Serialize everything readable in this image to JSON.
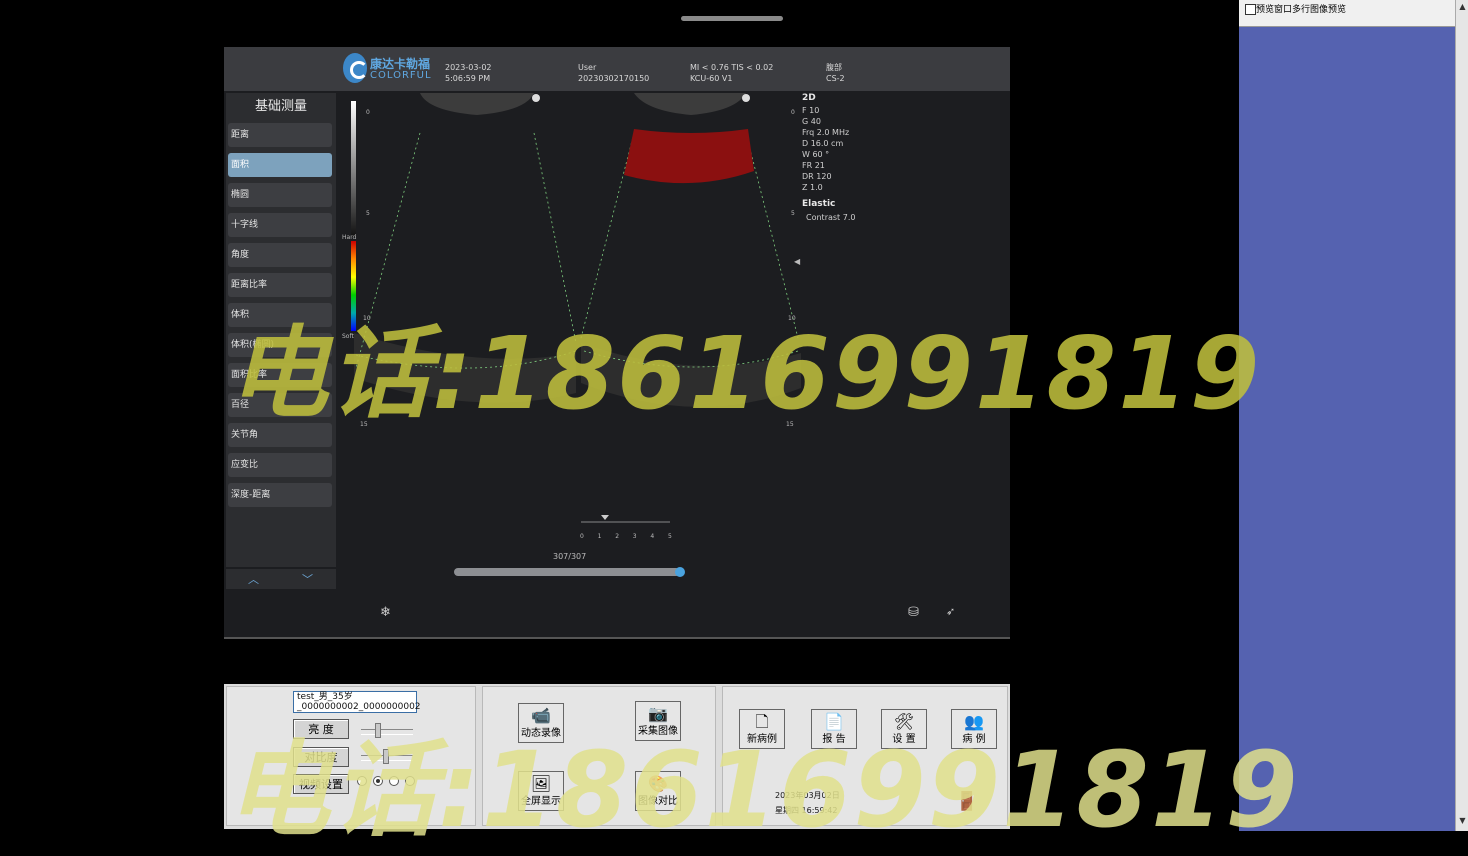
{
  "header": {
    "brand_cn": "康达卡勒福",
    "brand_en": "COLORFUL",
    "date": "2023-03-02",
    "time": "5:06:59 PM",
    "user": "User",
    "exam_id": "20230302170150",
    "mi_tis": "MI < 0.76  TIS < 0.02",
    "probe": "KCU-60 V1",
    "region": "腹部",
    "preset": "CS-2"
  },
  "menu": {
    "title": "基础测量",
    "items": [
      {
        "label": "距离",
        "selected": false
      },
      {
        "label": "面积",
        "selected": true
      },
      {
        "label": "椭圆",
        "selected": false
      },
      {
        "label": "十字线",
        "selected": false
      },
      {
        "label": "角度",
        "selected": false
      },
      {
        "label": "距离比率",
        "selected": false
      },
      {
        "label": "体积",
        "selected": false
      },
      {
        "label": "体积(椭圆)",
        "selected": false
      },
      {
        "label": "面积比率",
        "selected": false
      },
      {
        "label": "百径",
        "selected": false
      },
      {
        "label": "关节角",
        "selected": false
      },
      {
        "label": "应变比",
        "selected": false
      },
      {
        "label": "深度-距离",
        "selected": false
      }
    ],
    "up_icon": "chevron-up-icon",
    "down_icon": "chevron-down-icon"
  },
  "image": {
    "mode": "2D",
    "params": "F 10\nG 40\nFrq 2.0 MHz\nD 16.0 cm\nW 60 °\nFR 21\nDR 120\nZ 1.0",
    "elastic_title": "Elastic",
    "contrast": "Contrast 7.0",
    "depth_ticks": [
      "0",
      "5",
      "10",
      "15"
    ],
    "bar_label_hard": "Hard",
    "bar_label_soft": "Soft",
    "timeline_ticks": [
      "0",
      "1",
      "2",
      "3",
      "4",
      "5"
    ],
    "cine_count": "307/307",
    "cine_progress": 1.0,
    "elastic_color": "#8b1010"
  },
  "bottom": {
    "patient": "test_男_35岁\n_0000000002_0000000002",
    "brightness_label": "亮  度",
    "contrast_label": "对比度",
    "video_label": "视频设置",
    "brightness_level": 0.3,
    "contrast_level": 0.45,
    "radio_selected": 1,
    "btn_record": "动态录像",
    "btn_capture": "采集图像",
    "btn_fullscreen": "全屏显示",
    "btn_compare": "图像对比",
    "btn_new_case": "新病例",
    "btn_report": "报 告",
    "btn_settings": "设 置",
    "btn_cases": "病 例",
    "date_line": "2023年03月02日",
    "time_line": "星期四 16:59:42"
  },
  "side": {
    "checkbox_label": "预览窗口多行图像预览"
  },
  "watermark": "电话:18616991819"
}
